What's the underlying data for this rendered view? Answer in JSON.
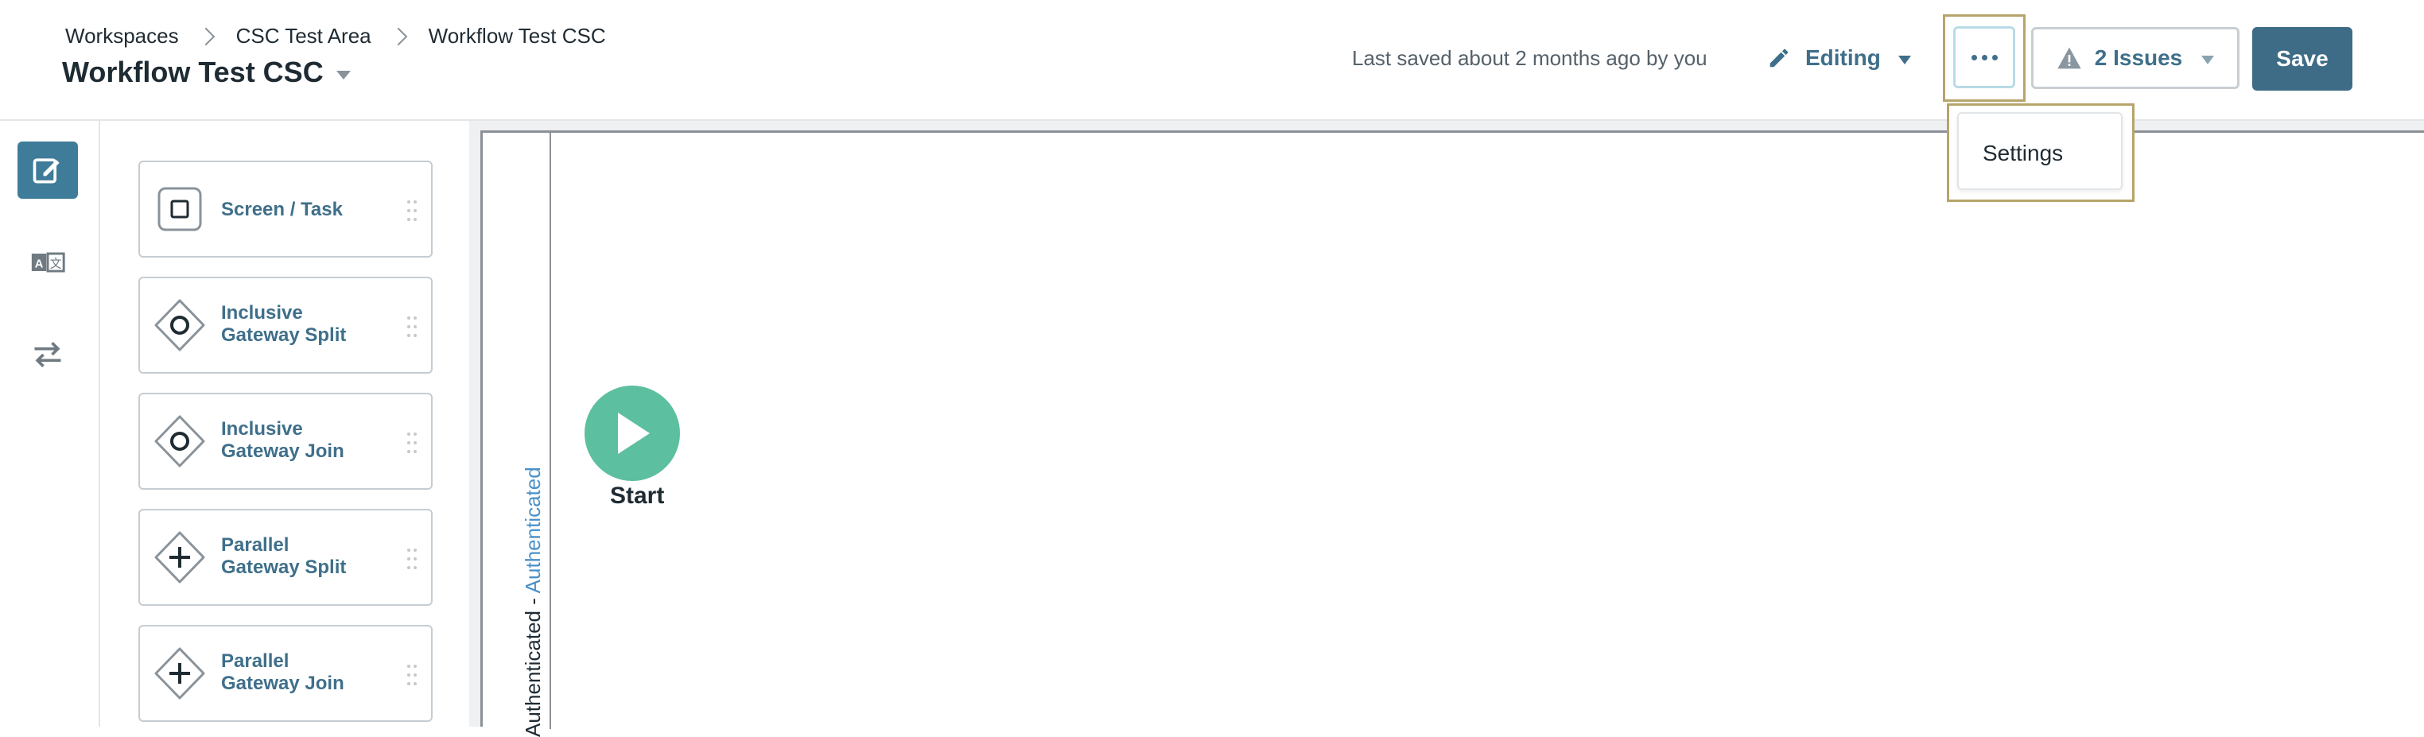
{
  "breadcrumb": [
    "Workspaces",
    "CSC Test Area",
    "Workflow Test CSC"
  ],
  "header": {
    "title": "Workflow Test CSC",
    "last_saved": "Last saved about 2 months ago by you",
    "mode_label": "Editing",
    "issues_label": "2 Issues",
    "save_label": "Save"
  },
  "more_menu": {
    "items": [
      "Settings"
    ]
  },
  "rail": {
    "items": [
      "edit-icon",
      "translate-icon",
      "swap-arrows-icon"
    ]
  },
  "palette": {
    "items": [
      {
        "line1": "Screen / Task",
        "line2": ""
      },
      {
        "line1": "Inclusive",
        "line2": "Gateway Split"
      },
      {
        "line1": "Inclusive",
        "line2": "Gateway Join"
      },
      {
        "line1": "Parallel",
        "line2": "Gateway Split"
      },
      {
        "line1": "Parallel",
        "line2": "Gateway Join"
      }
    ]
  },
  "canvas": {
    "lane_main": "Authenticated",
    "lane_separator": " - ",
    "lane_sub": "Authenticated",
    "start_label": "Start"
  },
  "colors": {
    "accent": "#3e6c87",
    "link": "#3f6f8a",
    "start_node": "#5cbfa0",
    "lane_sub_text": "#4a90c8",
    "highlight_border": "#b6a46a"
  }
}
